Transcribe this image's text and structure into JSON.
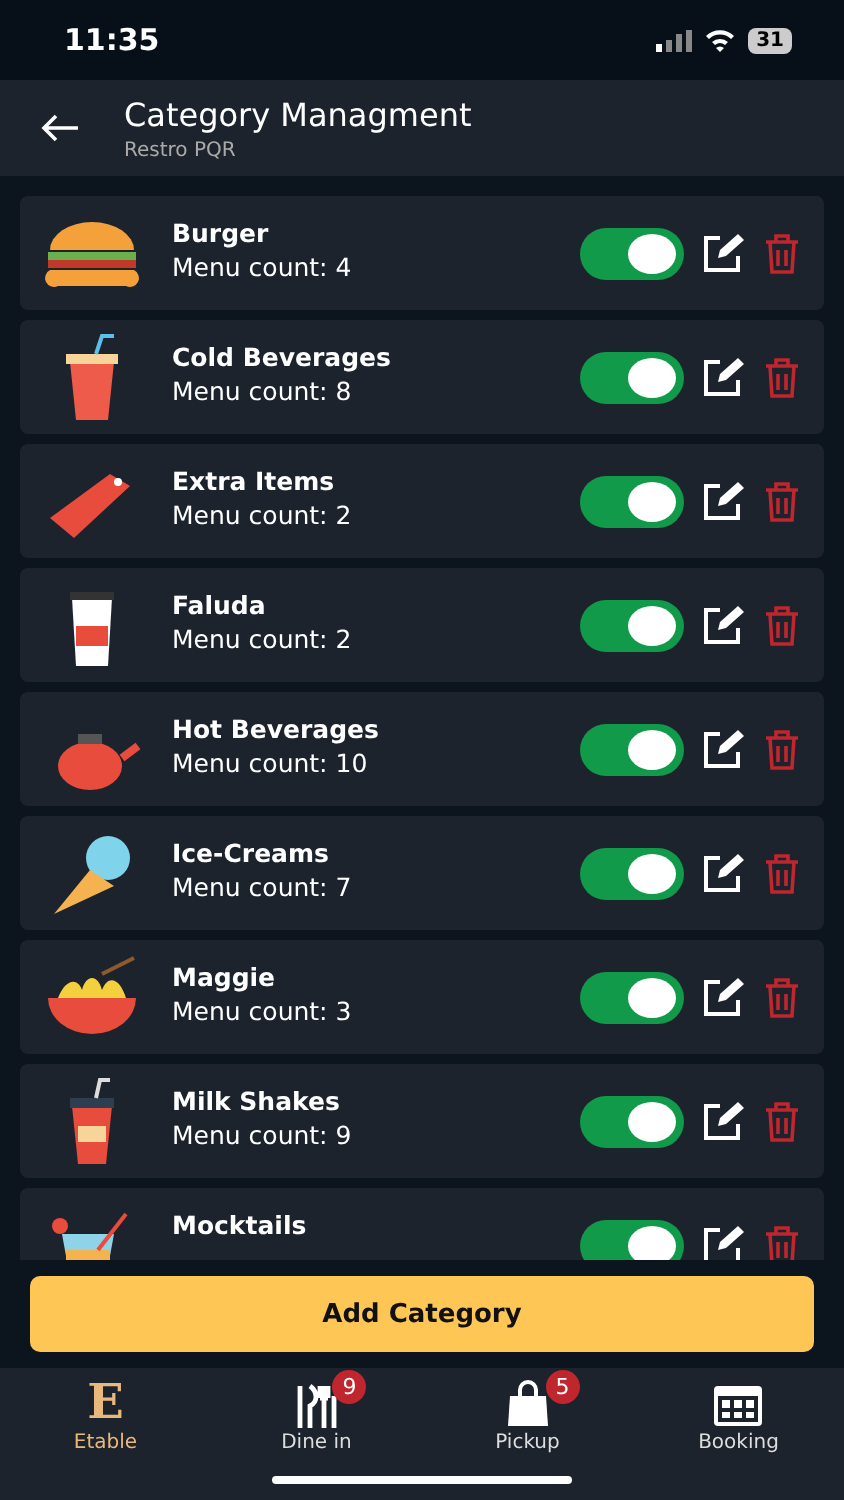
{
  "status_bar": {
    "time": "11:35",
    "battery": "31"
  },
  "header": {
    "title": "Category Managment",
    "subtitle": "Restro PQR"
  },
  "categories": [
    {
      "name": "Burger",
      "count": "Menu count: 4",
      "on": true
    },
    {
      "name": "Cold Beverages",
      "count": "Menu count: 8",
      "on": true
    },
    {
      "name": "Extra Items",
      "count": "Menu count: 2",
      "on": true
    },
    {
      "name": "Faluda",
      "count": "Menu count: 2",
      "on": true
    },
    {
      "name": "Hot Beverages",
      "count": "Menu count: 10",
      "on": true
    },
    {
      "name": "Ice-Creams",
      "count": "Menu count: 7",
      "on": true
    },
    {
      "name": "Maggie",
      "count": "Menu count: 3",
      "on": true
    },
    {
      "name": "Milk Shakes",
      "count": "Menu count: 9",
      "on": true
    },
    {
      "name": "Mocktails",
      "on": true
    }
  ],
  "add_button": "Add Category",
  "tabs": [
    {
      "label": "Etable",
      "logo": "E",
      "selected": true
    },
    {
      "label": "Dine in",
      "badge": "9",
      "selected": false
    },
    {
      "label": "Pickup",
      "badge": "5",
      "selected": false
    },
    {
      "label": "Booking",
      "selected": false
    }
  ]
}
